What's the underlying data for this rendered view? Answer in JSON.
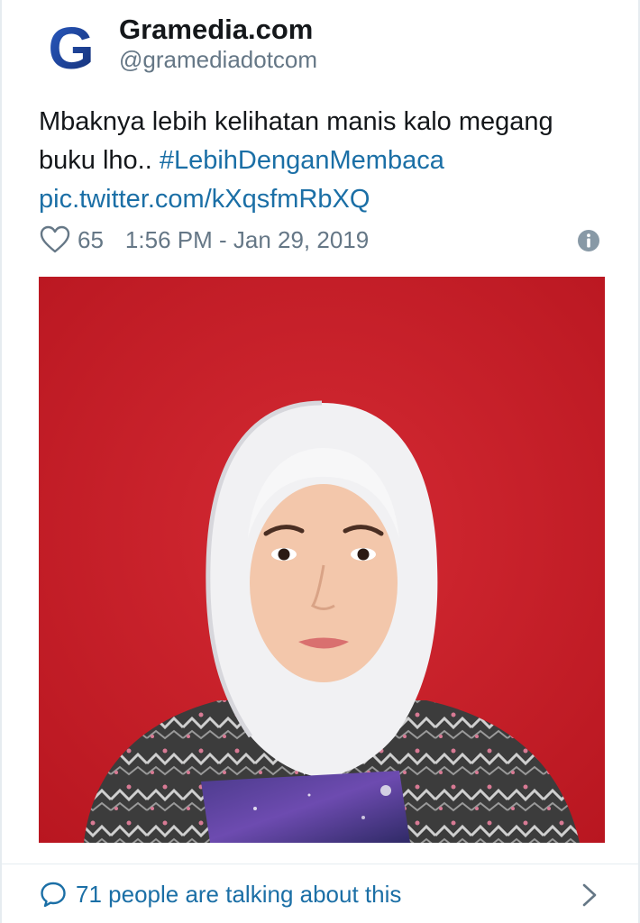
{
  "account": {
    "display_name": "Gramedia.com",
    "handle": "@gramediadotcom",
    "avatar_letter": "G",
    "avatar_icon": "gramedia-g-logo"
  },
  "tweet": {
    "text_before": "Mbaknya lebih kelihatan manis kalo megang buku lho.. ",
    "hashtag": "#LebihDenganMembaca",
    "pic_link": "pic.twitter.com/kXqsfmRbXQ",
    "like_count": "65",
    "timestamp": "1:56 PM - Jan 29, 2019",
    "photo_alt": "Portrait photo of a woman in a white hijab holding a book against a red background"
  },
  "footer": {
    "talking_label": "71 people are talking about this"
  },
  "icons": {
    "like": "heart-icon",
    "info": "info-icon",
    "reply": "speech-bubble-icon",
    "more": "chevron-right-icon"
  },
  "colors": {
    "link": "#1b6fa6",
    "text": "#14171a",
    "muted": "#657786",
    "brand_blue": "#1d3f91",
    "photo_background": "#c8202a"
  }
}
